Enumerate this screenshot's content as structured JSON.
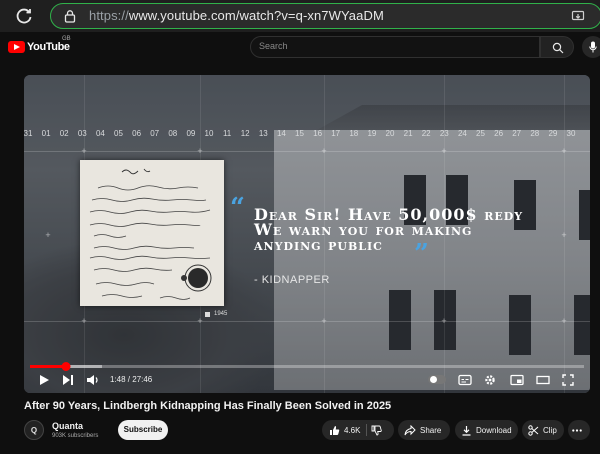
{
  "browser": {
    "url_scheme": "https://",
    "url_rest": "www.youtube.com/watch?v=q-xn7WYaaDM"
  },
  "header": {
    "logo_text": "YouTube",
    "region": "GB",
    "search_placeholder": "Search"
  },
  "video": {
    "timeline_ticks": [
      "31",
      "01",
      "02",
      "03",
      "04",
      "05",
      "06",
      "07",
      "08",
      "09",
      "10",
      "11",
      "12",
      "13",
      "14",
      "15",
      "16",
      "17",
      "18",
      "19",
      "20",
      "21",
      "22",
      "23",
      "24",
      "25",
      "26",
      "27",
      "28",
      "29",
      "30"
    ],
    "quote_line1": "Dear Sir! Have 50,000$ redy",
    "quote_line2": "We warn you for making",
    "quote_line3": "anyding public",
    "attribution": "- KIDNAPPER",
    "year_label": "1945",
    "quote_color": "#4aa3e0"
  },
  "player": {
    "current_time": "1:48",
    "duration": "27:46",
    "time_display": "1:48 / 27:46",
    "progress_fraction": 0.065,
    "buffered_fraction": 0.13,
    "accent": "#ff0000"
  },
  "meta": {
    "title": "After 90 Years, Lindbergh Kidnapping Has Finally Been Solved in 2025",
    "channel_initial": "Q",
    "channel_name": "Quanta",
    "subscribers": "903K subscribers",
    "subscribe_label": "Subscribe",
    "likes": "4.6K",
    "share_label": "Share",
    "download_label": "Download",
    "clip_label": "Clip"
  }
}
